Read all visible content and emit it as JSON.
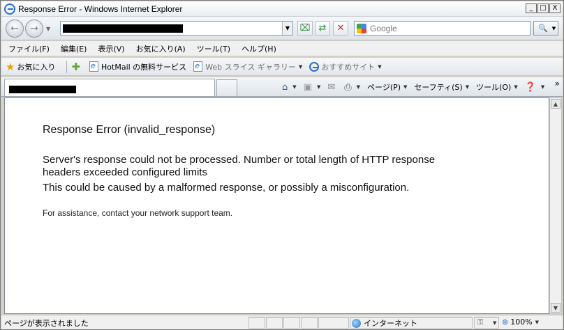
{
  "window": {
    "title": "Response Error - Windows Internet Explorer",
    "controls": [
      "_",
      "□",
      "X"
    ]
  },
  "navbar": {
    "search_placeholder": "Google"
  },
  "menu": {
    "items": [
      "ファイル(F)",
      "編集(E)",
      "表示(V)",
      "お気に入り(A)",
      "ツール(T)",
      "ヘルプ(H)"
    ]
  },
  "favorites": {
    "label": "お気に入り",
    "items": [
      "HotMail の無料サービス",
      "Web スライス ギャラリー",
      "おすすめサイト"
    ]
  },
  "commandbar": {
    "page": "ページ(P)",
    "safety": "セーフティ(S)",
    "tools": "ツール(O)"
  },
  "content": {
    "title": "Response Error (invalid_response)",
    "message": "Server's response could not be processed. Number or total length of HTTP response headers exceeded configured limits",
    "cause": "This could be caused by a malformed response, or possibly a misconfiguration.",
    "help": "For assistance, contact your network support team."
  },
  "status": {
    "text": "ページが表示されました",
    "zone": "インターネット",
    "zoom": "100%"
  }
}
